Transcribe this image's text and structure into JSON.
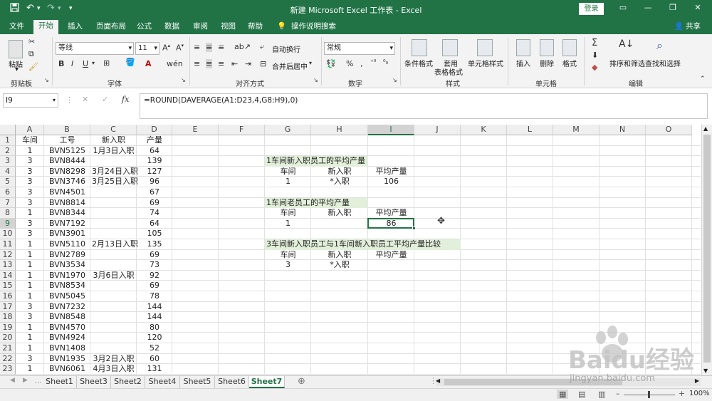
{
  "titlebar": {
    "title": "新建 Microsoft Excel 工作表 - Excel",
    "login": "登录"
  },
  "menu": [
    "文件",
    "开始",
    "插入",
    "页面布局",
    "公式",
    "数据",
    "审阅",
    "视图",
    "帮助",
    "操作说明搜索"
  ],
  "share": "共享",
  "ribbon": {
    "paste": "粘贴",
    "font_name": "等线",
    "font_size": "11",
    "wrap": "自动换行",
    "merge": "合并后居中",
    "number_format": "常规",
    "cond_format": "条件格式",
    "table_format_1": "套用",
    "table_format_2": "表格格式",
    "cell_style": "单元格样式",
    "insert": "插入",
    "delete": "删除",
    "format": "格式",
    "sort": "排序和筛选",
    "find": "查找和选择",
    "groups": {
      "clipboard": "剪贴板",
      "font": "字体",
      "alignment": "对齐方式",
      "number": "数字",
      "styles": "样式",
      "cells": "单元格",
      "editing": "编辑"
    }
  },
  "formula_bar": {
    "name_box": "I9",
    "fx": "fx",
    "formula": "=ROUND(DAVERAGE(A1:D23,4,G8:H9),0)"
  },
  "columns": [
    "A",
    "B",
    "C",
    "D",
    "E",
    "F",
    "G",
    "H",
    "I",
    "J",
    "K",
    "L",
    "M",
    "N",
    "O"
  ],
  "rows": [
    "1",
    "2",
    "3",
    "4",
    "5",
    "6",
    "7",
    "8",
    "9",
    "10",
    "11",
    "12",
    "13",
    "14",
    "15",
    "16",
    "17",
    "18",
    "19",
    "20",
    "21",
    "22",
    "23"
  ],
  "table": {
    "headers": [
      "车间",
      "工号",
      "新入职",
      "产量"
    ],
    "data": [
      [
        "1",
        "BVN5125",
        "1月3日入职",
        "64"
      ],
      [
        "3",
        "BVN8444",
        "",
        "139"
      ],
      [
        "3",
        "BVN8298",
        "3月24日入职",
        "127"
      ],
      [
        "3",
        "BVN3746",
        "3月25日入职",
        "96"
      ],
      [
        "3",
        "BVN4501",
        "",
        "67"
      ],
      [
        "3",
        "BVN8814",
        "",
        "69"
      ],
      [
        "1",
        "BVN8344",
        "",
        "74"
      ],
      [
        "3",
        "BVN7192",
        "",
        "64"
      ],
      [
        "3",
        "BVN3901",
        "",
        "105"
      ],
      [
        "1",
        "BVN5110",
        "2月13日入职",
        "135"
      ],
      [
        "1",
        "BVN2789",
        "",
        "69"
      ],
      [
        "1",
        "BVN3534",
        "",
        "73"
      ],
      [
        "1",
        "BVN1970",
        "3月6日入职",
        "92"
      ],
      [
        "1",
        "BVN8534",
        "",
        "69"
      ],
      [
        "1",
        "BVN5045",
        "",
        "78"
      ],
      [
        "3",
        "BVN7232",
        "",
        "144"
      ],
      [
        "3",
        "BVN8548",
        "",
        "144"
      ],
      [
        "1",
        "BVN4570",
        "",
        "80"
      ],
      [
        "1",
        "BVN4924",
        "",
        "120"
      ],
      [
        "1",
        "BVN1408",
        "",
        "52"
      ],
      [
        "3",
        "BVN1935",
        "3月2日入职",
        "60"
      ],
      [
        "1",
        "BVN6061",
        "4月3日入职",
        "131"
      ]
    ]
  },
  "blocks": {
    "b1_title": "1车间新入职员工的平均产量",
    "b1_h1": "车间",
    "b1_h2": "新入职",
    "b1_h3": "平均产量",
    "b1_v1": "1",
    "b1_v2": "*入职",
    "b1_v3": "106",
    "b2_title": "1车间老员工的平均产量",
    "b2_h1": "车间",
    "b2_h2": "新入职",
    "b2_h3": "平均产量",
    "b2_v1": "1",
    "b2_v3": "86",
    "b3_title": "3车间新入职员工与1车间新入职员工平均产量比较",
    "b3_h1": "车间",
    "b3_h2": "新入职",
    "b3_h3": "平均产量",
    "b3_v1": "3",
    "b3_v2": "*入职"
  },
  "sheets": [
    "Sheet1",
    "Sheet3",
    "Sheet2",
    "Sheet4",
    "Sheet5",
    "Sheet6",
    "Sheet7"
  ],
  "active_sheet": "Sheet7",
  "status": {
    "zoom": "100%"
  },
  "watermark": {
    "brand": "Baidu经验",
    "url": "jingyan.baidu.com"
  },
  "colors": {
    "excel_green": "#217346",
    "highlight": "#e2efda"
  }
}
